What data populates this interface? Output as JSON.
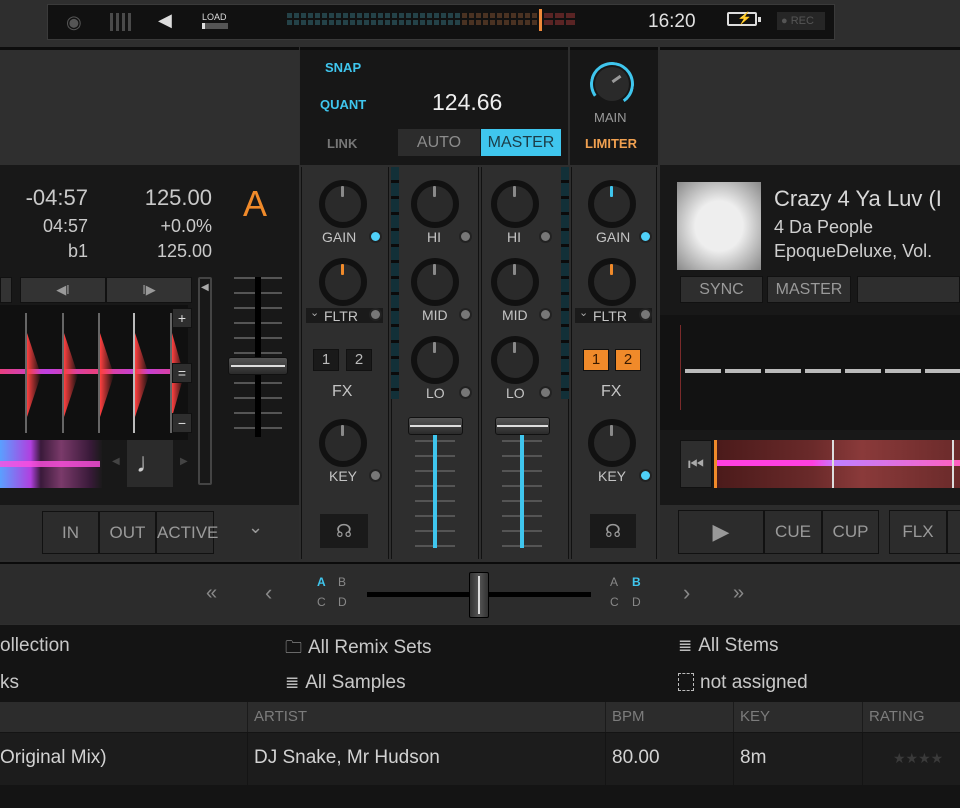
{
  "topbar": {
    "icons": [
      "midi-icon",
      "mixer-icon",
      "speaker-icon",
      "load-meter-icon"
    ],
    "load_label": "LOAD",
    "clock": "16:20",
    "battery_icon": "⚡",
    "rec_label": "● REC"
  },
  "master": {
    "snap_label": "SNAP",
    "quant_label": "QUANT",
    "link_label": "LINK",
    "tempo": "124.66",
    "auto_label": "AUTO",
    "master_label": "MASTER",
    "main_label": "MAIN",
    "limiter_label": "LIMITER",
    "accent_color": "#3fc6ee",
    "limiter_color": "#f0a050"
  },
  "deck_a": {
    "letter": "A",
    "remaining_time": "-04:57",
    "elapsed_time": "04:57",
    "beat": "b1",
    "bpm": "125.00",
    "pitch": "+0.0%",
    "original_bpm": "125.00",
    "beatjump_back": "◀I",
    "beatjump_fwd": "I▶",
    "zoom_in": "+",
    "zoom_reset": "=",
    "zoom_out": "−",
    "note_icon": "♩",
    "loop_in": "IN",
    "loop_out": "OUT",
    "loop_active": "ACTIVE",
    "more_icon": "⌄"
  },
  "mixer": {
    "channel_a": {
      "gain": "GAIN",
      "filter": "FLTR",
      "fx1": "1",
      "fx2": "2",
      "fx": "FX",
      "key": "KEY",
      "filter_arrow": "⌄"
    },
    "eq_a": {
      "hi": "HI",
      "mid": "MID",
      "lo": "LO"
    },
    "eq_b": {
      "hi": "HI",
      "mid": "MID",
      "lo": "LO"
    },
    "channel_b": {
      "gain": "GAIN",
      "filter": "FLTR",
      "fx1": "1",
      "fx2": "2",
      "fx": "FX",
      "key": "KEY",
      "filter_arrow": "⌄"
    },
    "headphone_icon": "🎧"
  },
  "deck_b": {
    "title": "Crazy 4 Ya Luv (I",
    "artist": "4 Da People",
    "album": "EpoqueDeluxe, Vol.",
    "sync_label": "SYNC",
    "master_label": "MASTER",
    "play_icon": "▶",
    "cue_label": "CUE",
    "cup_label": "CUP",
    "flx_label": "FLX",
    "to_start_icon": "⏮"
  },
  "crossfader": {
    "prev_page": "«",
    "prev": "‹",
    "next": "›",
    "next_page": "»",
    "left_assign": [
      "A",
      "B",
      "C",
      "D"
    ],
    "right_assign": [
      "A",
      "B",
      "C",
      "D"
    ],
    "left_active": "A",
    "right_active": "B"
  },
  "browser": {
    "items": [
      {
        "label": "ollection",
        "icon": ""
      },
      {
        "label": "All Remix Sets",
        "icon": "folder-icon"
      },
      {
        "label": "All Stems",
        "icon": "list-icon"
      },
      {
        "label": "ks",
        "icon": ""
      },
      {
        "label": "All Samples",
        "icon": "list-icon"
      },
      {
        "label": "not assigned",
        "icon": "dashed-box-icon"
      }
    ],
    "columns": [
      "",
      "ARTIST",
      "BPM",
      "KEY",
      "RATING"
    ],
    "rows": [
      {
        "title": "Original Mix)",
        "artist": "DJ Snake, Mr Hudson",
        "bpm": "80.00",
        "key": "8m",
        "rating": "★★★★"
      }
    ]
  }
}
